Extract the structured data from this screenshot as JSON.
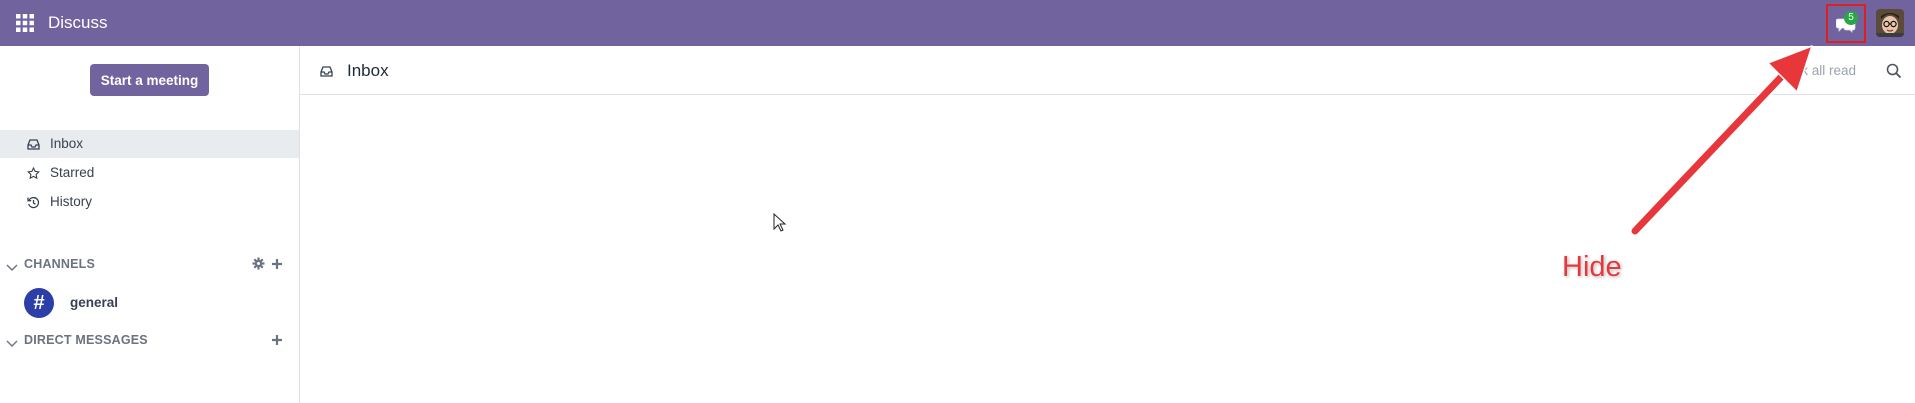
{
  "navbar": {
    "app_title": "Discuss",
    "chat_badge_count": "5",
    "accent_color": "#71639e"
  },
  "sidebar": {
    "start_meeting_label": "Start a meeting",
    "mailboxes": [
      {
        "label": "Inbox",
        "icon": "inbox-icon",
        "active": true
      },
      {
        "label": "Starred",
        "icon": "star-icon",
        "active": false
      },
      {
        "label": "History",
        "icon": "history-icon",
        "active": false
      }
    ],
    "channels_title": "CHANNELS",
    "channels": [
      {
        "name": "general",
        "avatar_symbol": "#"
      }
    ],
    "direct_messages_title": "DIRECT MESSAGES"
  },
  "main": {
    "title": "Inbox",
    "mark_all_read_label": "Mark all read"
  },
  "annotation": {
    "label": "Hide",
    "color": "#e8373b"
  }
}
